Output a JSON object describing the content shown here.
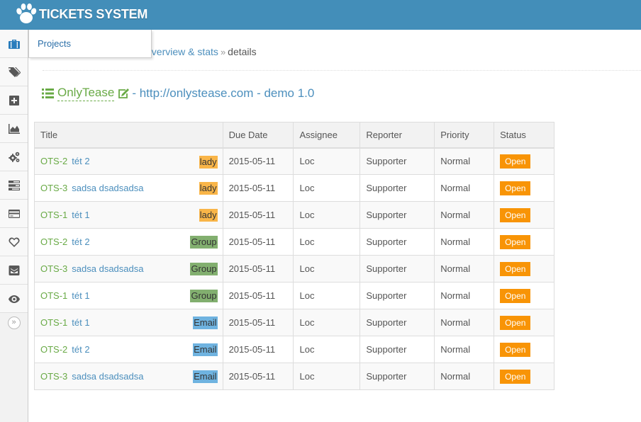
{
  "app": {
    "title": "TICKETS SYSTEM"
  },
  "submenu": {
    "projects_label": "Projects"
  },
  "breadcrumb": {
    "overview_label": "overview & stats",
    "separator": "»",
    "current": "details"
  },
  "project": {
    "name": "OnlyTease",
    "description": "- http://onlystease.com - demo 1.0"
  },
  "colors": {
    "header": "#438eb9",
    "link_blue": "#4c8fbd",
    "green": "#69aa46",
    "tag_lady": "#f9b548",
    "tag_group": "#82af6f",
    "tag_email": "#6fb3e0",
    "status_open": "#f89406"
  },
  "sidebar": {
    "icons": [
      "briefcase-icon",
      "tags-icon",
      "plus-square-icon",
      "area-chart-icon",
      "cogs-icon",
      "tasks-icon",
      "credit-card-icon",
      "heart-icon",
      "envelope-icon",
      "eye-icon"
    ],
    "toggle_symbol": "»"
  },
  "table": {
    "columns": [
      "Title",
      "Due Date",
      "Assignee",
      "Reporter",
      "Priority",
      "Status"
    ],
    "rows": [
      {
        "id": "OTS-2",
        "name": "tét 2",
        "tag": "lady",
        "due": "2015-05-11",
        "assignee": "Loc",
        "reporter": "Supporter",
        "priority": "Normal",
        "status": "Open"
      },
      {
        "id": "OTS-3",
        "name": "sadsa dsadsadsa",
        "tag": "lady",
        "due": "2015-05-11",
        "assignee": "Loc",
        "reporter": "Supporter",
        "priority": "Normal",
        "status": "Open"
      },
      {
        "id": "OTS-1",
        "name": "tét 1",
        "tag": "lady",
        "due": "2015-05-11",
        "assignee": "Loc",
        "reporter": "Supporter",
        "priority": "Normal",
        "status": "Open"
      },
      {
        "id": "OTS-2",
        "name": "tét 2",
        "tag": "Group",
        "due": "2015-05-11",
        "assignee": "Loc",
        "reporter": "Supporter",
        "priority": "Normal",
        "status": "Open"
      },
      {
        "id": "OTS-3",
        "name": "sadsa dsadsadsa",
        "tag": "Group",
        "due": "2015-05-11",
        "assignee": "Loc",
        "reporter": "Supporter",
        "priority": "Normal",
        "status": "Open"
      },
      {
        "id": "OTS-1",
        "name": "tét 1",
        "tag": "Group",
        "due": "2015-05-11",
        "assignee": "Loc",
        "reporter": "Supporter",
        "priority": "Normal",
        "status": "Open"
      },
      {
        "id": "OTS-1",
        "name": "tét 1",
        "tag": "Email",
        "due": "2015-05-11",
        "assignee": "Loc",
        "reporter": "Supporter",
        "priority": "Normal",
        "status": "Open"
      },
      {
        "id": "OTS-2",
        "name": "tét 2",
        "tag": "Email",
        "due": "2015-05-11",
        "assignee": "Loc",
        "reporter": "Supporter",
        "priority": "Normal",
        "status": "Open"
      },
      {
        "id": "OTS-3",
        "name": "sadsa dsadsadsa",
        "tag": "Email",
        "due": "2015-05-11",
        "assignee": "Loc",
        "reporter": "Supporter",
        "priority": "Normal",
        "status": "Open"
      }
    ]
  }
}
